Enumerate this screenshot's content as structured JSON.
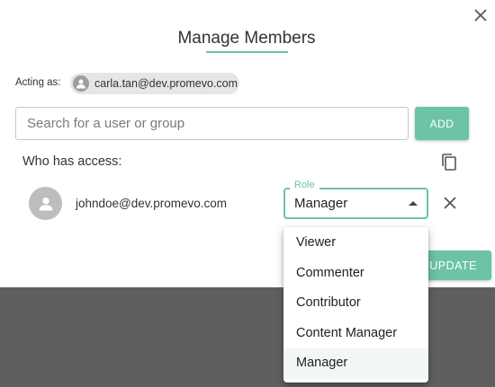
{
  "dialog": {
    "title": "Manage Members",
    "acting_label": "Acting as:",
    "acting_email": "carla.tan@dev.promevo.com",
    "search_placeholder": "Search for a user or group",
    "add_label": "ADD",
    "who_label": "Who has access:",
    "update_label": "UPDATE"
  },
  "members": [
    {
      "email": "johndoe@dev.promevo.com",
      "role_label": "Role",
      "role": "Manager"
    }
  ],
  "role_options": [
    "Viewer",
    "Commenter",
    "Contributor",
    "Content Manager",
    "Manager"
  ],
  "selected_role": "Manager",
  "icons": {
    "close": "close-icon",
    "avatar": "person-icon",
    "copy": "copy-icon",
    "remove": "close-icon",
    "dropdown": "caret-up-icon"
  },
  "colors": {
    "accent": "#6cc3a8",
    "backdrop": "#5f5f5f",
    "avatar_bg": "#bdbdbd",
    "chip_bg": "#e6e6e6"
  }
}
